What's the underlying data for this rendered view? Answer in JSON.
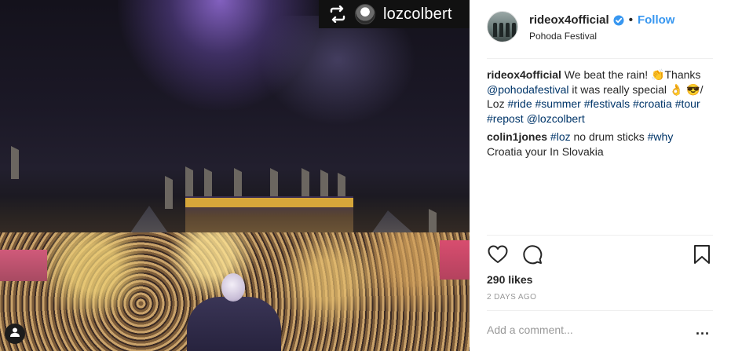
{
  "photo": {
    "repost_username": "lozcolbert",
    "repost_icon": "repost-icon",
    "tag_icon": "user-tag-icon"
  },
  "header": {
    "username": "rideox4official",
    "separator": "•",
    "follow_label": "Follow",
    "location": "Pohoda Festival",
    "verified_color": "#3897f0"
  },
  "caption": {
    "username": "rideox4official",
    "text_1": " We beat the rain! ",
    "emoji_clap": "👏",
    "text_2": "Thanks ",
    "mention_1": "@pohodafestival",
    "text_3": " it was really special ",
    "emoji_ok": "👌",
    "emoji_cool": "😎",
    "text_4": "/ Loz ",
    "hashtags": [
      "#ride",
      "#summer",
      "#festivals",
      "#croatia",
      "#tour",
      "#repost"
    ],
    "mention_2": "@lozcolbert"
  },
  "comment_1": {
    "username": "colin1jones",
    "hashtag_1": "#loz",
    "text_1": " no drum sticks ",
    "hashtag_2": "#why",
    "text_2": "Croatia your In Slovakia"
  },
  "stats": {
    "likes": "290 likes",
    "time_ago": "2 DAYS AGO"
  },
  "comment_box": {
    "placeholder": "Add a comment...",
    "more_label": "..."
  },
  "colors": {
    "link_blue": "#3897f0",
    "hashtag_navy": "#003569",
    "text": "#262626",
    "muted": "#999999",
    "divider": "#efefef"
  }
}
